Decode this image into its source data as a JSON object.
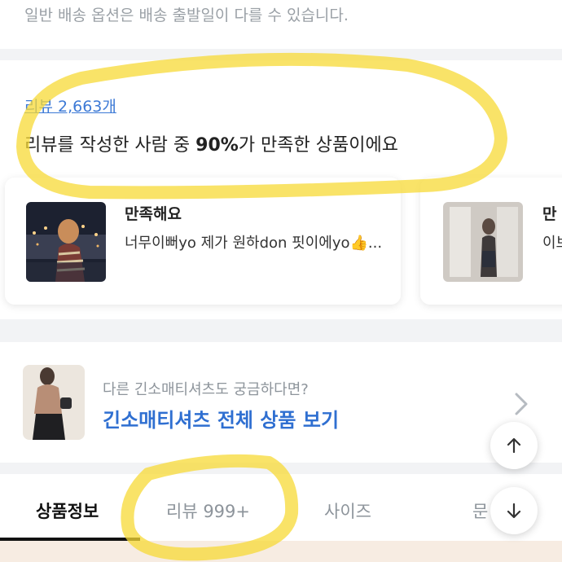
{
  "shipping": {
    "notice": "일반 배송 옵션은 배송 출발일이 다를 수 있습니다."
  },
  "reviews": {
    "count_link": "리뷰 2,663개",
    "summary_prefix": "리뷰를 작성한 사람 중 ",
    "summary_percent": "90%",
    "summary_suffix": "가 만족한 상품이에요",
    "cards": [
      {
        "rating": "만족해요",
        "text": "너무이뻐yo 제가 원하don 핏이에yo👍..."
      },
      {
        "rating": "만",
        "text": "이브서"
      }
    ]
  },
  "related": {
    "subtitle": "다른 긴소매티셔츠도 궁금하다면?",
    "link": "긴소매티셔츠 전체 상품 보기"
  },
  "tabs": [
    {
      "label": "상품정보",
      "active": true
    },
    {
      "label": "리뷰 999+",
      "active": false
    },
    {
      "label": "사이즈",
      "active": false
    },
    {
      "label": "문",
      "active": false
    }
  ],
  "colors": {
    "link_blue": "#2f6fd1",
    "highlight_yellow": "#f7d935",
    "muted_text": "#8d949b"
  },
  "icons": {
    "related_chevron": "chevron-right-icon",
    "scroll_up": "arrow-up-icon",
    "scroll_down": "arrow-down-icon"
  }
}
